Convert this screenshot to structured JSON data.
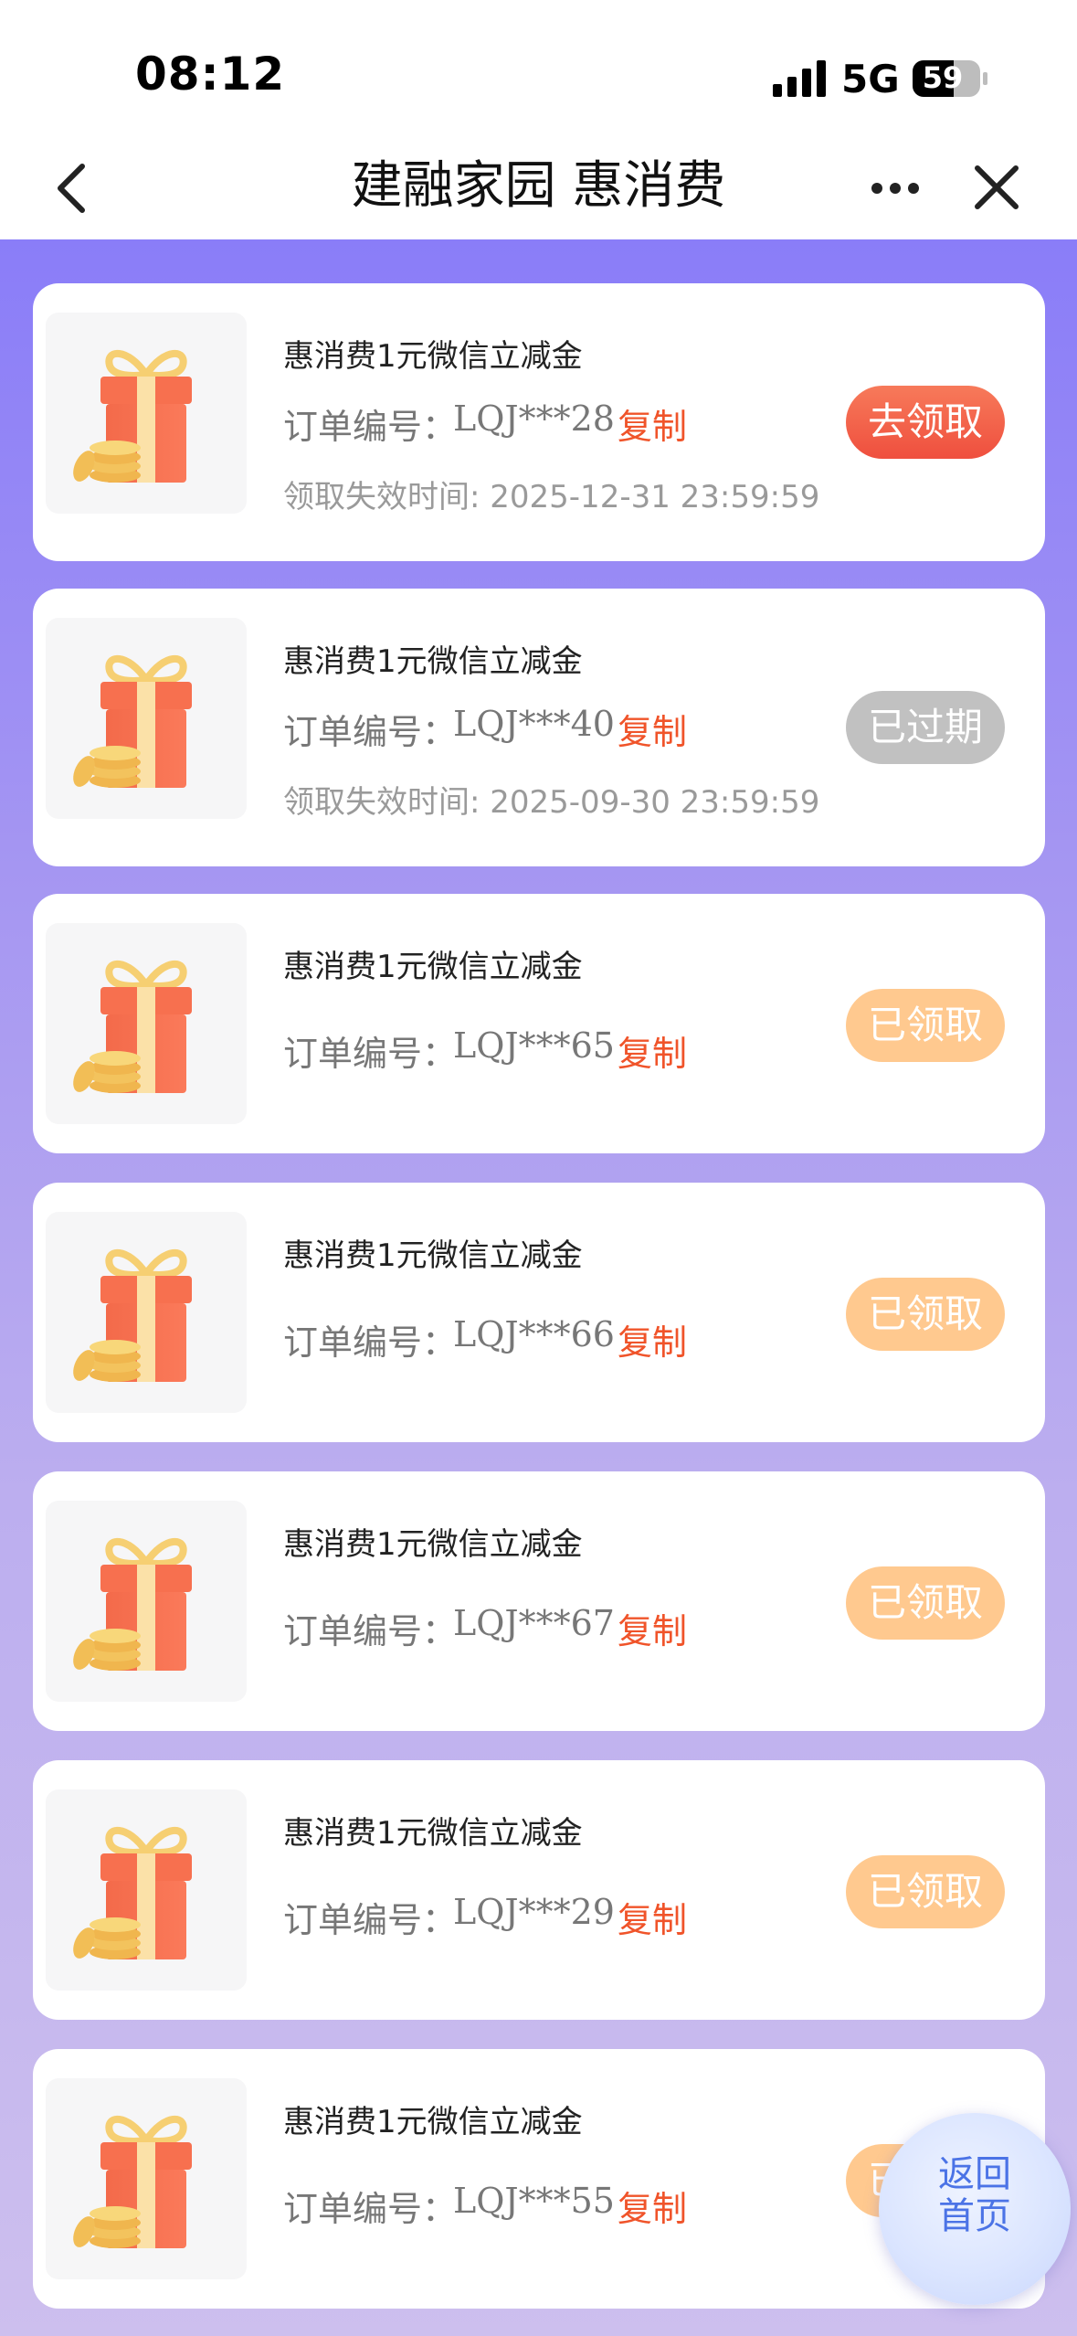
{
  "status_bar": {
    "time": "08:12",
    "network": "5G",
    "battery": "59",
    "icons": [
      "signal-icon",
      "battery-icon"
    ]
  },
  "nav": {
    "title": "建融家园 惠消费",
    "icons": [
      "back-icon",
      "more-icon",
      "close-icon"
    ]
  },
  "orders": [
    {
      "title": "惠消费1元微信立减金",
      "order_label": "订单编号：",
      "order_no": "LQJ***28",
      "copy": "复制",
      "expire": "领取失效时间: 2025-12-31 23:59:59",
      "status": "去领取",
      "status_type": "claim"
    },
    {
      "title": "惠消费1元微信立减金",
      "order_label": "订单编号：",
      "order_no": "LQJ***40",
      "copy": "复制",
      "expire": "领取失效时间: 2025-09-30 23:59:59",
      "status": "已过期",
      "status_type": "expired"
    },
    {
      "title": "惠消费1元微信立减金",
      "order_label": "订单编号：",
      "order_no": "LQJ***65",
      "copy": "复制",
      "status": "已领取",
      "status_type": "claimed"
    },
    {
      "title": "惠消费1元微信立减金",
      "order_label": "订单编号：",
      "order_no": "LQJ***66",
      "copy": "复制",
      "status": "已领取",
      "status_type": "claimed"
    },
    {
      "title": "惠消费1元微信立减金",
      "order_label": "订单编号：",
      "order_no": "LQJ***67",
      "copy": "复制",
      "status": "已领取",
      "status_type": "claimed"
    },
    {
      "title": "惠消费1元微信立减金",
      "order_label": "订单编号：",
      "order_no": "LQJ***29",
      "copy": "复制",
      "status": "已领取",
      "status_type": "claimed"
    },
    {
      "title": "惠消费1元微信立减金",
      "order_label": "订单编号：",
      "order_no": "LQJ***55",
      "copy": "复制",
      "status": "已领取",
      "status_type": "claimed"
    }
  ],
  "home_button": {
    "label": "返回\n首页"
  },
  "colors": {
    "accent": "#f0542a",
    "claim": "#ef4f3e",
    "expired": "#c1c1c1",
    "claimed": "#ffc98f",
    "background_top": "#8a7df8",
    "background_bottom": "#cdbfee"
  }
}
